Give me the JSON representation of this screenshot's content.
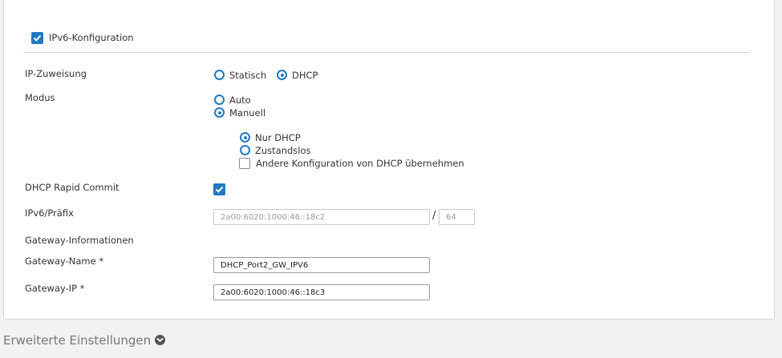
{
  "ipv6_config": {
    "label": "IPv6-Konfiguration",
    "checked": true
  },
  "ip_assignment": {
    "label": "IP-Zuweisung",
    "options": [
      {
        "label": "Statisch",
        "selected": false
      },
      {
        "label": "DHCP",
        "selected": true
      }
    ]
  },
  "mode": {
    "label": "Modus",
    "options": [
      {
        "label": "Auto",
        "selected": false
      },
      {
        "label": "Manuell",
        "selected": true
      }
    ],
    "sub_options": [
      {
        "label": "Nur DHCP",
        "selected": true
      },
      {
        "label": "Zustandslos",
        "selected": false
      }
    ],
    "other_config": {
      "label": "Andere Konfiguration von DHCP übernehmen",
      "checked": false
    }
  },
  "dhcp_rapid_commit": {
    "label": "DHCP Rapid Commit",
    "checked": true
  },
  "ipv6_prefix": {
    "label": "IPv6/Präfix",
    "address_placeholder": "2a00:6020:1000:46::18c2",
    "separator": "/",
    "prefix_placeholder": "64"
  },
  "gateway": {
    "section_label": "Gateway-Informationen",
    "name_label": "Gateway-Name *",
    "name_value": "DHCP_Port2_GW_IPV6",
    "ip_label": "Gateway-IP *",
    "ip_value": "2a00:6020:1000:46::18c3"
  },
  "advanced": {
    "label": "Erweiterte Einstellungen",
    "icon": "chevron-down-circle-icon"
  },
  "colors": {
    "accent": "#1f7ac4",
    "background": "#f2f2f2",
    "panel": "#ffffff"
  }
}
